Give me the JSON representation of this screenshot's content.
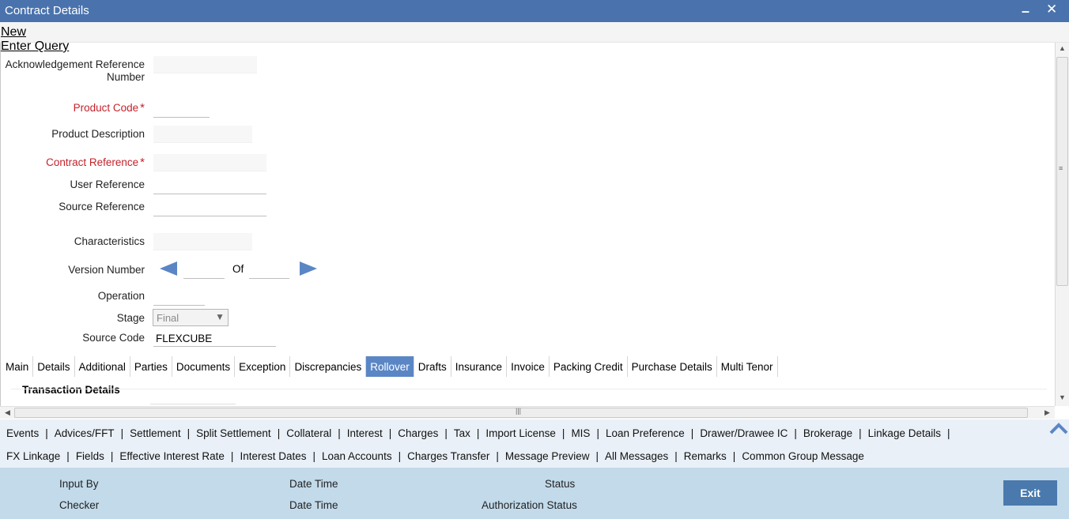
{
  "window": {
    "title": "Contract Details",
    "minimize": "▬",
    "close": "✕"
  },
  "toolbar": {
    "new": "New",
    "enter_query": "Enter Query"
  },
  "form": {
    "ack_ref_label_1": "Acknowledgement Reference",
    "ack_ref_label_2": "Number",
    "product_code_label": "Product Code",
    "product_description_label": "Product Description",
    "contract_reference_label": "Contract Reference",
    "user_reference_label": "User Reference",
    "source_reference_label": "Source Reference",
    "characteristics_label": "Characteristics",
    "version_number_label": "Version Number",
    "of_label": "Of",
    "operation_label": "Operation",
    "stage_label": "Stage",
    "stage_value": "Final",
    "source_code_label": "Source Code",
    "source_code_value": "FLEXCUBE",
    "required_mark": "*"
  },
  "tabs": [
    "Main",
    "Details",
    "Additional",
    "Parties",
    "Documents",
    "Exception",
    "Discrepancies",
    "Rollover",
    "Drafts",
    "Insurance",
    "Invoice",
    "Packing Credit",
    "Purchase Details",
    "Multi Tenor"
  ],
  "active_tab": "Rollover",
  "section_title": "Transaction Details",
  "sublinks_row1": [
    "Events",
    "Advices/FFT",
    "Settlement",
    "Split Settlement",
    "Collateral",
    "Interest",
    "Charges",
    "Tax",
    "Import License",
    "MIS",
    "Loan Preference",
    "Drawer/Drawee IC",
    "Brokerage",
    "Linkage Details"
  ],
  "sublinks_row2": [
    "FX Linkage",
    "Fields",
    "Effective Interest Rate",
    "Interest Dates",
    "Loan Accounts",
    "Charges Transfer",
    "Message Preview",
    "All Messages",
    "Remarks",
    "Common Group Message"
  ],
  "footer": {
    "input_by": "Input By",
    "checker": "Checker",
    "date_time_1": "Date Time",
    "date_time_2": "Date Time",
    "status": "Status",
    "authorization_status": "Authorization Status",
    "exit": "Exit"
  },
  "colors": {
    "titlebar": "#4a73ad",
    "required": "#c4222b",
    "active_tab": "#5b86c5",
    "footer": "#c2daea",
    "exit_button": "#4a79ad"
  }
}
